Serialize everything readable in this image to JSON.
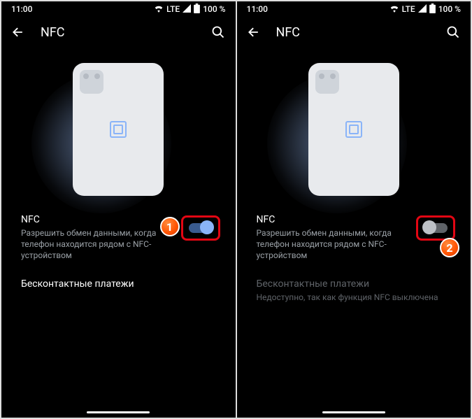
{
  "status": {
    "time": "11:00",
    "network": "LTE",
    "battery": "100 %"
  },
  "header": {
    "title": "NFC"
  },
  "left": {
    "nfc_title": "NFC",
    "nfc_sub": "Разрешить обмен данными, когда телефон находится рядом с NFC-устройством",
    "toggle_on": true,
    "payments_title": "Бесконтактные платежи",
    "badge": "1"
  },
  "right": {
    "nfc_title": "NFC",
    "nfc_sub": "Разрешить обмен данными, когда телефон находится рядом с NFC-устройством",
    "toggle_on": false,
    "payments_title": "Бесконтактные платежи",
    "payments_sub": "Недоступно, так как функция NFC выключена",
    "badge": "2"
  }
}
